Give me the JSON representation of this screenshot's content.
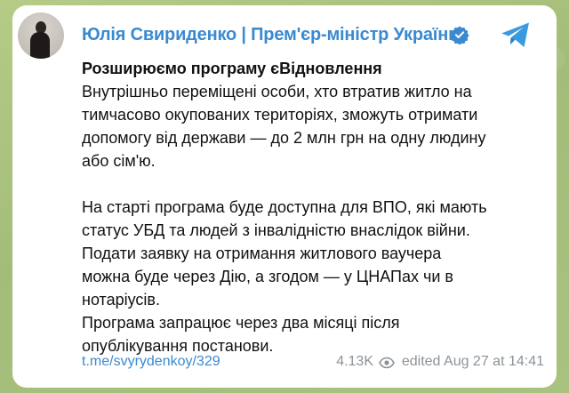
{
  "channel": {
    "name": "Юлія Свириденко | Прем'єр-міністр України",
    "verified_icon": "verified-badge-icon",
    "avatar": "avatar"
  },
  "share_icon": "telegram-share-icon",
  "message": {
    "title": "Розширюємо програму єВідновлення",
    "paragraph1": "Внутрішньо переміщені особи, хто втратив житло на\nтимчасово окупованих територіях, зможуть отримати\nдопомогу від держави — до 2 млн грн на одну людину\nабо сім'ю.",
    "paragraph2": "На старті програма буде доступна для ВПО, які мають\nстатус УБД та людей з інвалідністю внаслідок війни.\nПодати заявку на отримання житлового ваучера\nможна буде через Дію, а згодом — у ЦНАПах чи в\nнотаріусів.\nПрограма запрацює через два місяці після\nопублікування постанови."
  },
  "footer": {
    "link": "t.me/svyrydenkoy/329",
    "views": "4.13K",
    "views_icon": "eye-icon",
    "edited": "edited  Aug 27 at 14:41"
  },
  "colors": {
    "accent": "#3a8ad0",
    "background": "#a9c27f",
    "meta_text": "#8b9398"
  }
}
